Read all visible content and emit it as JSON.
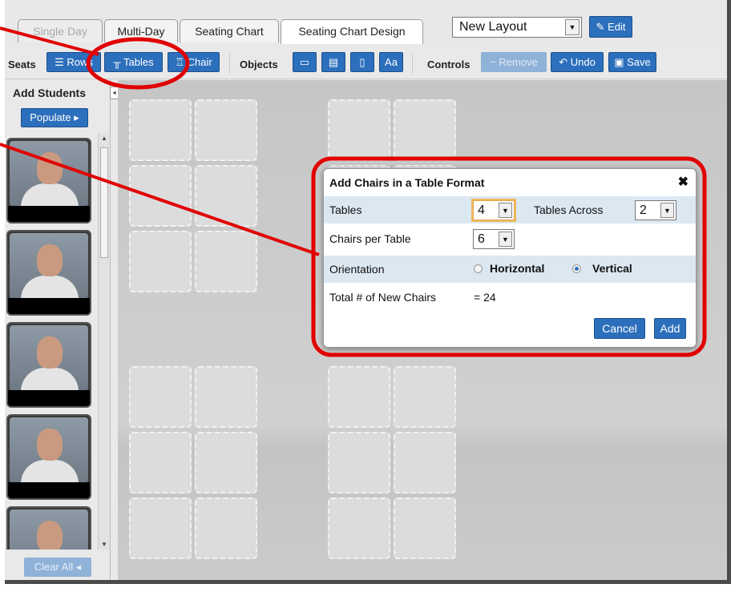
{
  "tabs": [
    {
      "label": "Single Day",
      "state": "disabled"
    },
    {
      "label": "Multi-Day",
      "state": "normal"
    },
    {
      "label": "Seating Chart",
      "state": "normal"
    },
    {
      "label": "Seating Chart Design",
      "state": "active"
    }
  ],
  "layout_select": {
    "value": "New Layout"
  },
  "edit_button": {
    "label": "Edit",
    "icon": "pencil-icon"
  },
  "toolbar": {
    "seats_label": "Seats",
    "rows_button": "Rows",
    "tables_button": "Tables",
    "chair_button": "Chair",
    "objects_label": "Objects",
    "text_button": "Aa",
    "controls_label": "Controls",
    "remove_button": "Remove",
    "undo_button": "Undo",
    "save_button": "Save"
  },
  "sidebar": {
    "title": "Add Students",
    "populate_button": "Populate",
    "clear_all_button": "Clear All"
  },
  "dialog": {
    "title": "Add Chairs in a Table Format",
    "tables_label": "Tables",
    "tables_value": "4",
    "tables_across_label": "Tables Across",
    "tables_across_value": "2",
    "chairs_per_table_label": "Chairs per Table",
    "chairs_per_table_value": "6",
    "orientation_label": "Orientation",
    "orientation_horizontal": "Horizontal",
    "orientation_vertical": "Vertical",
    "orientation_selected": "Vertical",
    "total_label": "Total # of New Chairs",
    "total_value": "= 24",
    "cancel_button": "Cancel",
    "add_button": "Add"
  },
  "colors": {
    "accent_blue": "#2c6fbc",
    "annotation_red": "#e00000"
  }
}
